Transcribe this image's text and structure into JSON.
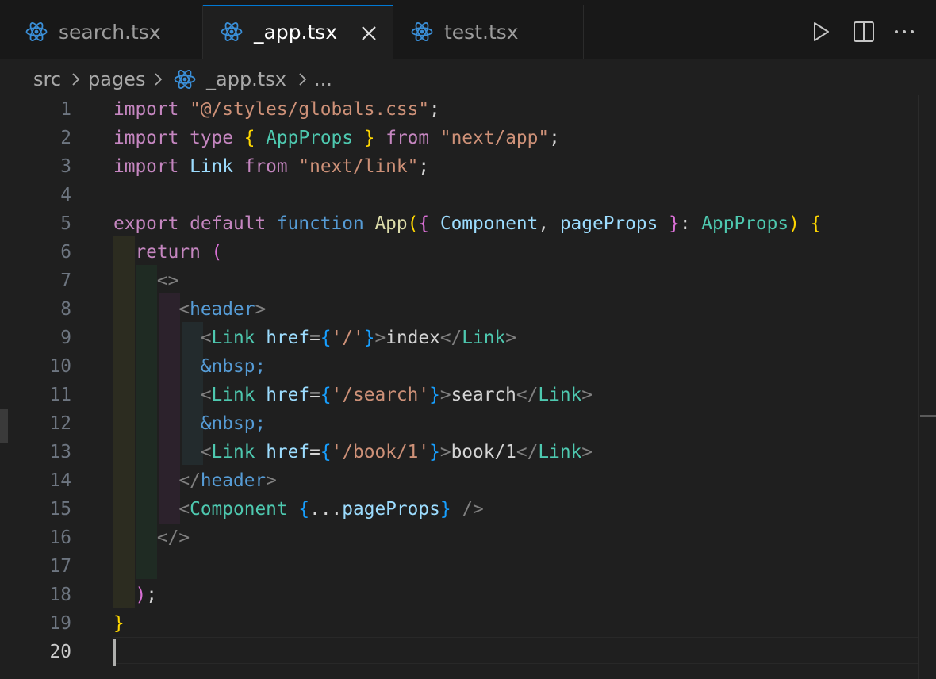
{
  "colors": {
    "background": "#1f1f1f",
    "tabbar_background": "#181818",
    "active_tab_accent": "#0078d4",
    "react_icon": "#3a8fd8",
    "keyword": "#c586c0",
    "string": "#ce9178",
    "type": "#4ec9b0",
    "variable": "#9cdcfe",
    "function": "#dcdcaa",
    "blue_keyword": "#569cd6",
    "bracket_level_1": "#ffd700",
    "bracket_level_2": "#da70d6",
    "bracket_level_3": "#179fff",
    "tag_punctuation": "#808080"
  },
  "tabs": [
    {
      "label": "search.tsx",
      "icon": "react-icon",
      "active": false
    },
    {
      "label": "_app.tsx",
      "icon": "react-icon",
      "active": true,
      "close_icon": "close-icon"
    },
    {
      "label": "test.tsx",
      "icon": "react-icon",
      "active": false
    }
  ],
  "toolbar": {
    "actions": [
      "run-icon",
      "split-editor-icon",
      "more-actions-icon"
    ]
  },
  "breadcrumb": {
    "items": [
      "src",
      "pages",
      "_app.tsx",
      "..."
    ],
    "file_icon": "react-icon"
  },
  "editor": {
    "current_line": 20,
    "line_numbers": [
      "1",
      "2",
      "3",
      "4",
      "5",
      "6",
      "7",
      "8",
      "9",
      "10",
      "11",
      "12",
      "13",
      "14",
      "15",
      "16",
      "17",
      "18",
      "19",
      "20"
    ],
    "lines": [
      [
        [
          "kw",
          "import"
        ],
        [
          "def",
          " "
        ],
        [
          "st",
          "\"@/styles/globals.css\""
        ],
        [
          "def",
          ";"
        ]
      ],
      [
        [
          "kw",
          "import"
        ],
        [
          "def",
          " "
        ],
        [
          "kw",
          "type"
        ],
        [
          "def",
          " "
        ],
        [
          "b1",
          "{"
        ],
        [
          "def",
          " "
        ],
        [
          "ty",
          "AppProps"
        ],
        [
          "def",
          " "
        ],
        [
          "b1",
          "}"
        ],
        [
          "def",
          " "
        ],
        [
          "kw",
          "from"
        ],
        [
          "def",
          " "
        ],
        [
          "st",
          "\"next/app\""
        ],
        [
          "def",
          ";"
        ]
      ],
      [
        [
          "kw",
          "import"
        ],
        [
          "def",
          " "
        ],
        [
          "va",
          "Link"
        ],
        [
          "def",
          " "
        ],
        [
          "kw",
          "from"
        ],
        [
          "def",
          " "
        ],
        [
          "st",
          "\"next/link\""
        ],
        [
          "def",
          ";"
        ]
      ],
      [],
      [
        [
          "kw",
          "export"
        ],
        [
          "def",
          " "
        ],
        [
          "kw",
          "default"
        ],
        [
          "def",
          " "
        ],
        [
          "bl",
          "function"
        ],
        [
          "def",
          " "
        ],
        [
          "fn",
          "App"
        ],
        [
          "b1",
          "("
        ],
        [
          "b2",
          "{"
        ],
        [
          "def",
          " "
        ],
        [
          "va",
          "Component"
        ],
        [
          "def",
          ", "
        ],
        [
          "va",
          "pageProps"
        ],
        [
          "def",
          " "
        ],
        [
          "b2",
          "}"
        ],
        [
          "def",
          ": "
        ],
        [
          "ty",
          "AppProps"
        ],
        [
          "b1",
          ")"
        ],
        [
          "def",
          " "
        ],
        [
          "b1",
          "{"
        ]
      ],
      [
        [
          "def",
          "  "
        ],
        [
          "kw",
          "return"
        ],
        [
          "def",
          " "
        ],
        [
          "b2",
          "("
        ]
      ],
      [
        [
          "def",
          "    "
        ],
        [
          "tg",
          "<>"
        ]
      ],
      [
        [
          "def",
          "      "
        ],
        [
          "tg",
          "<"
        ],
        [
          "bl",
          "header"
        ],
        [
          "tg",
          ">"
        ]
      ],
      [
        [
          "def",
          "        "
        ],
        [
          "tg",
          "<"
        ],
        [
          "ty",
          "Link"
        ],
        [
          "def",
          " "
        ],
        [
          "va",
          "href"
        ],
        [
          "def",
          "="
        ],
        [
          "b3",
          "{"
        ],
        [
          "st",
          "'/'"
        ],
        [
          "b3",
          "}"
        ],
        [
          "tg",
          ">"
        ],
        [
          "def",
          "index"
        ],
        [
          "tg",
          "</"
        ],
        [
          "ty",
          "Link"
        ],
        [
          "tg",
          ">"
        ]
      ],
      [
        [
          "def",
          "        "
        ],
        [
          "bl",
          "&nbsp;"
        ]
      ],
      [
        [
          "def",
          "        "
        ],
        [
          "tg",
          "<"
        ],
        [
          "ty",
          "Link"
        ],
        [
          "def",
          " "
        ],
        [
          "va",
          "href"
        ],
        [
          "def",
          "="
        ],
        [
          "b3",
          "{"
        ],
        [
          "st",
          "'/search'"
        ],
        [
          "b3",
          "}"
        ],
        [
          "tg",
          ">"
        ],
        [
          "def",
          "search"
        ],
        [
          "tg",
          "</"
        ],
        [
          "ty",
          "Link"
        ],
        [
          "tg",
          ">"
        ]
      ],
      [
        [
          "def",
          "        "
        ],
        [
          "bl",
          "&nbsp;"
        ]
      ],
      [
        [
          "def",
          "        "
        ],
        [
          "tg",
          "<"
        ],
        [
          "ty",
          "Link"
        ],
        [
          "def",
          " "
        ],
        [
          "va",
          "href"
        ],
        [
          "def",
          "="
        ],
        [
          "b3",
          "{"
        ],
        [
          "st",
          "'/book/1'"
        ],
        [
          "b3",
          "}"
        ],
        [
          "tg",
          ">"
        ],
        [
          "def",
          "book/1"
        ],
        [
          "tg",
          "</"
        ],
        [
          "ty",
          "Link"
        ],
        [
          "tg",
          ">"
        ]
      ],
      [
        [
          "def",
          "      "
        ],
        [
          "tg",
          "</"
        ],
        [
          "bl",
          "header"
        ],
        [
          "tg",
          ">"
        ]
      ],
      [
        [
          "def",
          "      "
        ],
        [
          "tg",
          "<"
        ],
        [
          "ty",
          "Component"
        ],
        [
          "def",
          " "
        ],
        [
          "b3",
          "{"
        ],
        [
          "def",
          "..."
        ],
        [
          "va",
          "pageProps"
        ],
        [
          "b3",
          "}"
        ],
        [
          "def",
          " "
        ],
        [
          "tg",
          "/>"
        ]
      ],
      [
        [
          "def",
          "    "
        ],
        [
          "tg",
          "</>"
        ]
      ],
      [],
      [
        [
          "def",
          "  "
        ],
        [
          "b2",
          ")"
        ],
        [
          "def",
          ";"
        ]
      ],
      [
        [
          "b1",
          "}"
        ]
      ],
      []
    ]
  }
}
